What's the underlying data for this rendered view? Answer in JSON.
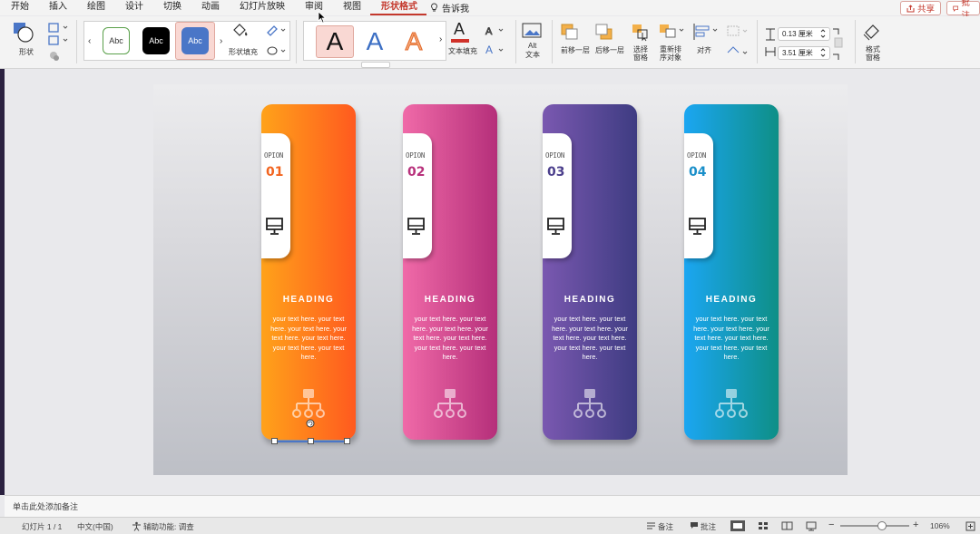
{
  "menu": {
    "items": [
      "开始",
      "插入",
      "绘图",
      "设计",
      "切换",
      "动画",
      "幻灯片放映",
      "审阅",
      "视图",
      "形状格式"
    ],
    "active_index": 9,
    "tell_me": "告诉我",
    "share": "共享",
    "comment": "批注"
  },
  "ribbon": {
    "shape_label": "形状",
    "style_samples": [
      "Abc",
      "Abc",
      "Abc"
    ],
    "shape_fill": "形状填充",
    "text_fill": "文本填充",
    "wordart_samples": [
      "A",
      "A",
      "A"
    ],
    "alt_text_line1": "Alt",
    "alt_text_line2": "文本",
    "bring_forward": "前移一层",
    "send_backward": "后移一层",
    "selection_pane_line1": "选择",
    "selection_pane_line2": "窗格",
    "reorder_line1": "重新排",
    "reorder_line2": "序对象",
    "align": "对齐",
    "height_value": "0.13 厘米",
    "width_value": "3.51 厘米",
    "format_pane_line1": "格式",
    "format_pane_line2": "窗格"
  },
  "slide": {
    "cards": [
      {
        "option": "OPION",
        "number": "01",
        "heading": "HEADING",
        "body": "your text here. your text here. your text here. your text here. your text here. your text here. your text here.",
        "color_start": "#ffa21a",
        "color_end": "#ff5a1f",
        "number_color": "#f2641f"
      },
      {
        "option": "OPION",
        "number": "02",
        "heading": "HEADING",
        "body": "your text here. your text here. your text here. your text here. your text here. your text here. your text here.",
        "color_start": "#f06aa8",
        "color_end": "#b52f7a",
        "number_color": "#b8327c"
      },
      {
        "option": "OPION",
        "number": "03",
        "heading": "HEADING",
        "body": "your text here. your text here. your text here. your text here. your text here. your text here. your text here.",
        "color_start": "#7a58b0",
        "color_end": "#3e3c82",
        "number_color": "#4b3f8c"
      },
      {
        "option": "OPION",
        "number": "04",
        "heading": "HEADING",
        "body": "your text here. your text here. your text here. your text here. your text here. your text here. your text here.",
        "color_start": "#1ba6f2",
        "color_end": "#0e8f86",
        "number_color": "#1a8fc9"
      }
    ]
  },
  "notes": {
    "placeholder": "单击此处添加备注"
  },
  "status": {
    "slide_count": "幻灯片 1 / 1",
    "language": "中文(中国)",
    "accessibility": "辅助功能: 调查",
    "notes": "备注",
    "comments": "批注",
    "zoom": "106%",
    "zoom_level_fraction": 0.6
  },
  "colors": {
    "accent": "#c4382c",
    "selection": "#4a76c7"
  }
}
